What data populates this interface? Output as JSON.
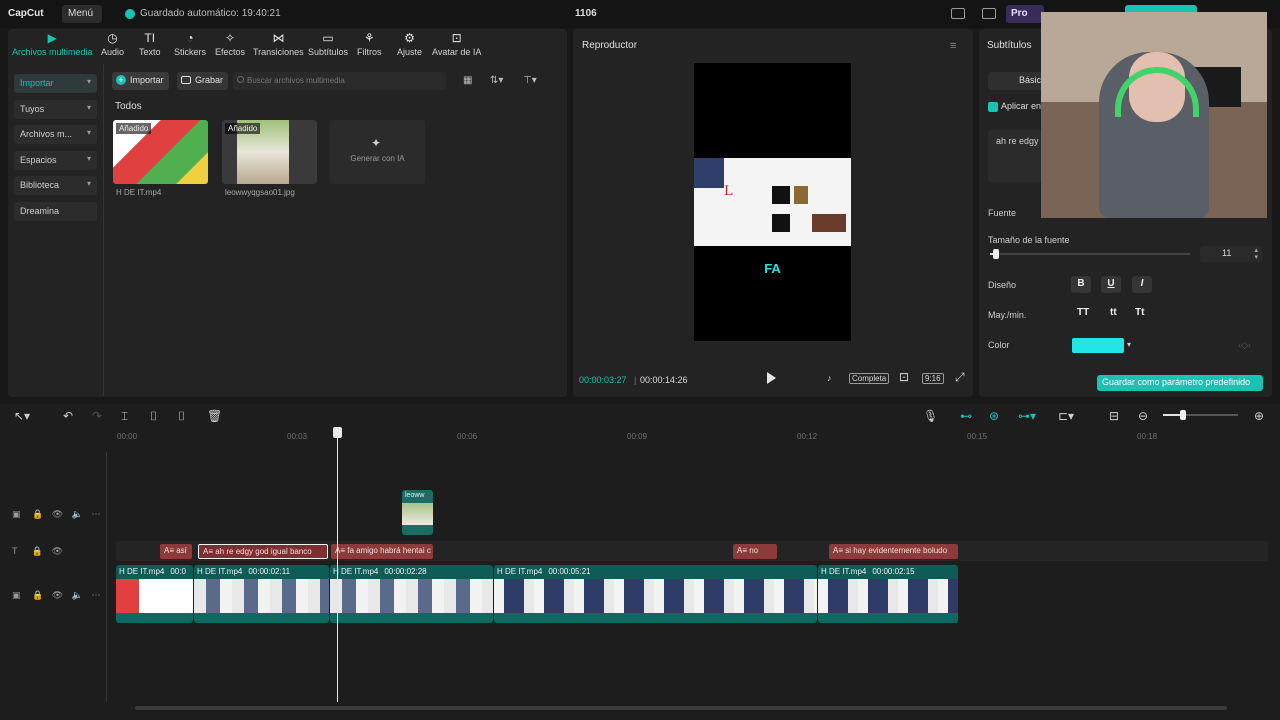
{
  "app": {
    "logo": "CapCut",
    "menu": "Menú",
    "autosave": "Guardado automático: 19:40:21",
    "project": "1106",
    "pro_label": "Pro"
  },
  "media_tabs": [
    {
      "label": "Archivos multimedia",
      "icon": "media-icon",
      "active": true
    },
    {
      "label": "Audio",
      "icon": "audio-icon"
    },
    {
      "label": "Texto",
      "icon": "text-icon"
    },
    {
      "label": "Stickers",
      "icon": "sticker-icon"
    },
    {
      "label": "Efectos",
      "icon": "effects-icon"
    },
    {
      "label": "Transiciones",
      "icon": "transition-icon"
    },
    {
      "label": "Subtítulos",
      "icon": "subtitles-icon"
    },
    {
      "label": "Filtros",
      "icon": "filter-icon"
    },
    {
      "label": "Ajuste",
      "icon": "adjust-icon"
    },
    {
      "label": "Avatar de IA",
      "icon": "avatar-icon"
    }
  ],
  "sidebar": [
    {
      "label": "Importar",
      "active": true
    },
    {
      "label": "Tuyos"
    },
    {
      "label": "Archivos m..."
    },
    {
      "label": "Espacios"
    },
    {
      "label": "Biblioteca"
    },
    {
      "label": "Dreamina"
    }
  ],
  "media": {
    "import_btn": "Importar",
    "record_btn": "Grabar",
    "search_placeholder": "Buscar archivos multimedia",
    "section": "Todos",
    "items": [
      {
        "name": "H DE IT.mp4",
        "tag": "Añadido"
      },
      {
        "name": "leowwyqgsao01.jpg",
        "tag": "Añadido"
      }
    ],
    "generate": "Generar con IA"
  },
  "player": {
    "title": "Reproductor",
    "overlay_text": "FA",
    "time_current": "00:00:03:27",
    "time_total": "00:00:14:26",
    "ratio_label": "Completa",
    "aspect_label": "9:16"
  },
  "props": {
    "title": "Subtítulos",
    "tab_basic": "Básic",
    "apply_label": "Aplicar en",
    "text_value": "ah re edgy",
    "font_label": "Fuente",
    "size_label": "Tamaño de la fuente",
    "size_value": "11",
    "size_fraction": 0.03,
    "design_label": "Diseño",
    "bold": "B",
    "underline": "U",
    "italic": "I",
    "case_label": "May./min.",
    "case_upper": "TT",
    "case_lower": "tt",
    "case_title": "Tt",
    "color_label": "Color",
    "color_value": "#22e5e8",
    "save_preset": "Guardar como parámetro predefinido"
  },
  "timeline": {
    "ruler": [
      "00:00",
      "00:03",
      "00:06",
      "00:09",
      "00:12",
      "00:15",
      "00:18"
    ],
    "image_clip": "leoww",
    "text_clips": [
      {
        "label": "así"
      },
      {
        "label": "ah re edgy god igual banco",
        "selected": true
      },
      {
        "label": "fa amigo habrá hentai c"
      },
      {
        "label": "no"
      },
      {
        "label": "si hay evidentemente boludo"
      }
    ],
    "video_clips": [
      {
        "name": "H DE IT.mp4",
        "dur": "00:0"
      },
      {
        "name": "H DE IT.mp4",
        "dur": "00:00:02:11"
      },
      {
        "name": "H DE IT.mp4",
        "dur": "00:00:02:28"
      },
      {
        "name": "H DE IT.mp4",
        "dur": "00:00:05:21"
      },
      {
        "name": "H DE IT.mp4",
        "dur": "00:00:02:15"
      }
    ]
  },
  "colors": {
    "accent": "#19c3b4",
    "text_clip": "#8c3a3a",
    "video_clip": "#0f5b55"
  }
}
